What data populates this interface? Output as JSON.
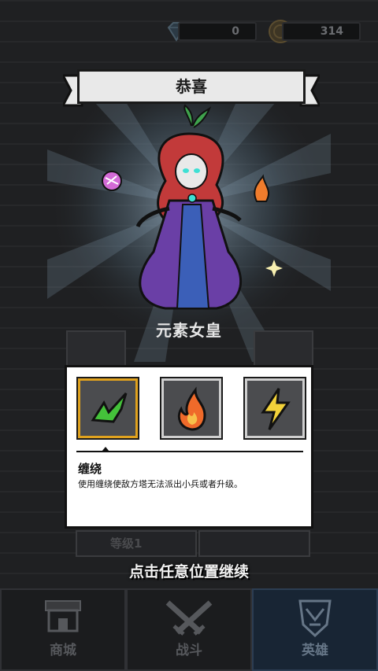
{
  "currencies": {
    "gems": "0",
    "coins": "314"
  },
  "banner": {
    "title": "恭喜"
  },
  "hero": {
    "name": "元素女皇"
  },
  "skill_panel": {
    "selected_skill_title": "缠绕",
    "selected_skill_desc": "使用缠绕使敌方塔无法派出小兵或者升级。",
    "skills": [
      "vine-skill",
      "fire-skill",
      "lightning-skill"
    ]
  },
  "background": {
    "level_label": "等级1"
  },
  "prompt": {
    "continue_text": "点击任意位置继续"
  },
  "nav": {
    "shop": "商城",
    "battle": "战斗",
    "heroes": "英雄",
    "active": "heroes"
  },
  "colors": {
    "selected_border": "#e0a21e",
    "hero_robe": "#6a3fa6",
    "hero_hair": "#c23a3a"
  }
}
